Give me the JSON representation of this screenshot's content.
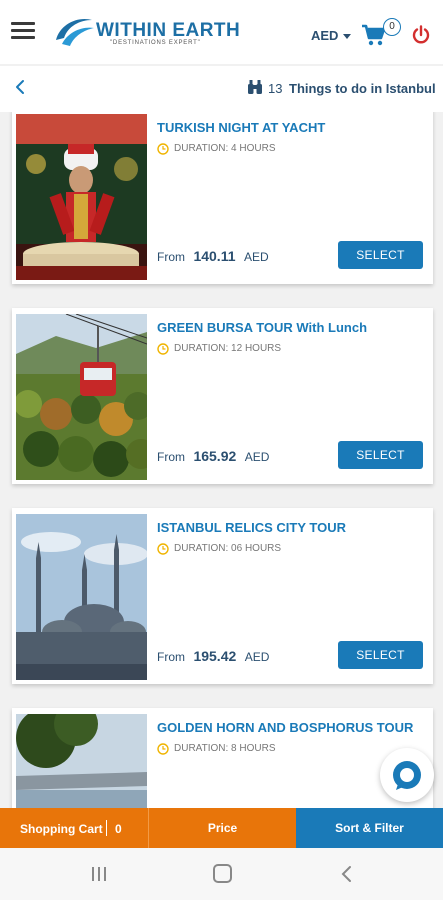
{
  "header": {
    "brand": "WITHIN EARTH",
    "tagline": "\"DESTINATIONS EXPERT\"",
    "currency": "AED",
    "cart_count": "0"
  },
  "subheader": {
    "count": "13",
    "label": "Things to do in Istanbul"
  },
  "tours": [
    {
      "title": "TURKISH NIGHT AT YACHT",
      "duration": "DURATION: 4 HOURS",
      "from": "From",
      "price": "140.11",
      "currency": "AED",
      "select": "SELECT"
    },
    {
      "title": "GREEN BURSA TOUR With Lunch",
      "duration": "DURATION: 12 HOURS",
      "from": "From",
      "price": "165.92",
      "currency": "AED",
      "select": "SELECT"
    },
    {
      "title": "ISTANBUL RELICS CITY TOUR",
      "duration": "DURATION: 06 HOURS",
      "from": "From",
      "price": "195.42",
      "currency": "AED",
      "select": "SELECT"
    },
    {
      "title": "GOLDEN HORN AND BOSPHORUS TOUR",
      "duration": "DURATION: 8 HOURS"
    }
  ],
  "bottom_bar": {
    "cart_label": "Shopping Cart",
    "cart_count": "0",
    "price_label": "Price",
    "sort_label": "Sort & Filter"
  },
  "colors": {
    "primary": "#1a7ab8",
    "accent": "#e8750a",
    "text_dark": "#2b4f70"
  },
  "icons": [
    "hamburger-icon",
    "cart-icon",
    "power-icon",
    "back-arrow-icon",
    "binoculars-icon",
    "clock-icon",
    "chat-icon"
  ]
}
